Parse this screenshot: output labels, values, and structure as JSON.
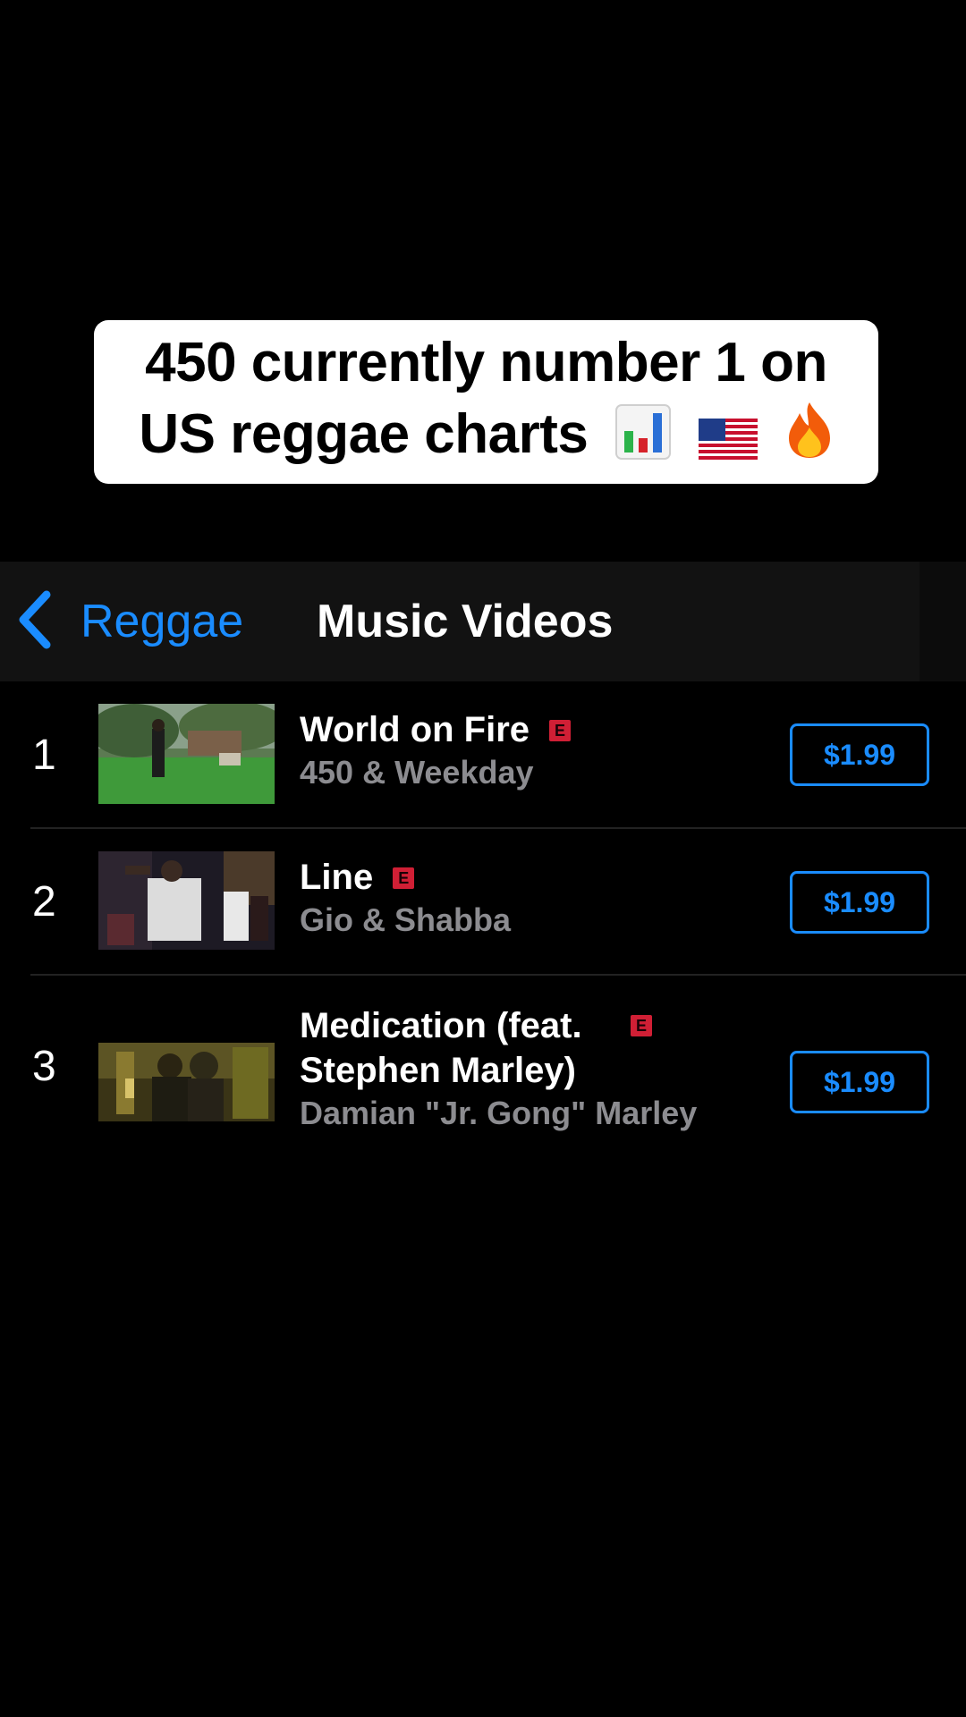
{
  "caption": {
    "text": "450 currently number 1 on US reggae charts",
    "icons": [
      "bar-chart-emoji-icon",
      "us-flag-emoji-icon",
      "fire-emoji-icon"
    ]
  },
  "nav": {
    "back_label": "Reggae",
    "title": "Music Videos",
    "back_icon": "chevron-left-icon"
  },
  "colors": {
    "accent": "#1a8cff",
    "background": "#000000",
    "navbar": "#121212",
    "explicit_badge": "#d01f35",
    "secondary_text": "#8c8c90"
  },
  "list": [
    {
      "rank": "1",
      "title": "World on Fire",
      "explicit": "E",
      "artist": "450 & Weekday",
      "price": "$1.99"
    },
    {
      "rank": "2",
      "title": "Line",
      "explicit": "E",
      "artist": "Gio & Shabba",
      "price": "$1.99"
    },
    {
      "rank": "3",
      "title": "Medication (feat. Stephen Marley)",
      "explicit": "E",
      "artist": "Damian \"Jr. Gong\" Marley",
      "price": "$1.99"
    }
  ]
}
